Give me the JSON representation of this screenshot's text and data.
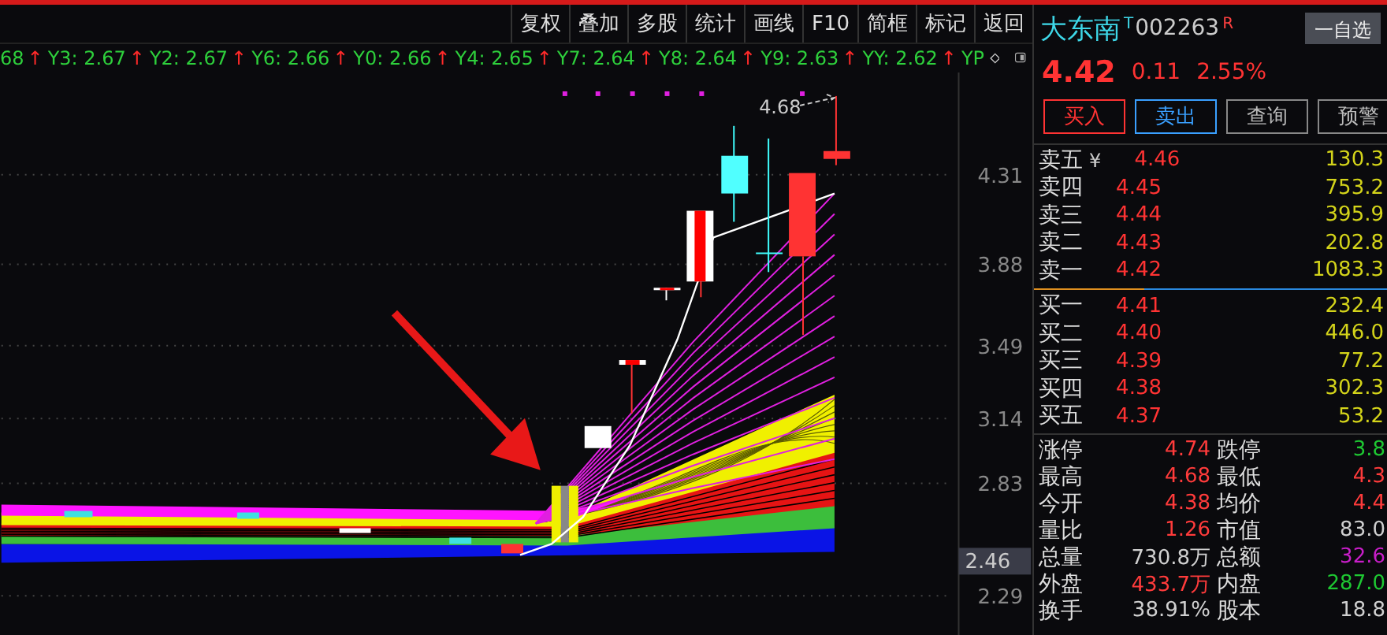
{
  "toolbar": {
    "buttons": [
      "复权",
      "叠加",
      "多股",
      "统计",
      "画线",
      "F10",
      "简框",
      "标记",
      "返回"
    ]
  },
  "indicators": {
    "items": [
      {
        "text": "68",
        "arrow": "↑"
      },
      {
        "text": "Y3: 2.67",
        "arrow": "↑"
      },
      {
        "text": "Y2: 2.67",
        "arrow": "↑"
      },
      {
        "text": "Y6: 2.66",
        "arrow": "↑"
      },
      {
        "text": "Y0: 2.66",
        "arrow": "↑"
      },
      {
        "text": "Y4: 2.65",
        "arrow": "↑"
      },
      {
        "text": "Y7: 2.64",
        "arrow": "↑"
      },
      {
        "text": "Y8: 2.64",
        "arrow": "↑"
      },
      {
        "text": "Y9: 2.63",
        "arrow": "↑"
      },
      {
        "text": "YY: 2.62",
        "arrow": "↑"
      },
      {
        "text": "YP"
      }
    ]
  },
  "chart": {
    "axis_labels": [
      "4.31",
      "3.88",
      "3.49",
      "3.14",
      "2.83",
      "2.29"
    ],
    "current_tag": "2.46",
    "high_label": "4.68"
  },
  "quote": {
    "name": "大东南",
    "name_mark": "T",
    "code": "002263",
    "code_mark": "R",
    "watch_button": "一自选",
    "price": "4.42",
    "change": "0.11",
    "change_pct": "2.55%",
    "actions": [
      {
        "label": "买入",
        "kind": "buy"
      },
      {
        "label": "卖出",
        "kind": "sell"
      },
      {
        "label": "查询",
        "kind": "plain"
      },
      {
        "label": "预警",
        "kind": "plain"
      }
    ]
  },
  "order_book": {
    "asks": [
      {
        "label": "卖五",
        "mark": "¥",
        "price": "4.46",
        "volume": "130.3"
      },
      {
        "label": "卖四",
        "price": "4.45",
        "volume": "753.2"
      },
      {
        "label": "卖三",
        "price": "4.44",
        "volume": "395.9"
      },
      {
        "label": "卖二",
        "price": "4.43",
        "volume": "202.8"
      },
      {
        "label": "卖一",
        "price": "4.42",
        "volume": "1083.3"
      }
    ],
    "bids": [
      {
        "label": "买一",
        "price": "4.41",
        "volume": "232.4"
      },
      {
        "label": "买二",
        "price": "4.40",
        "volume": "446.0"
      },
      {
        "label": "买三",
        "price": "4.39",
        "volume": "77.2"
      },
      {
        "label": "买四",
        "price": "4.38",
        "volume": "302.3"
      },
      {
        "label": "买五",
        "price": "4.37",
        "volume": "53.2"
      }
    ]
  },
  "stats": [
    {
      "label": "涨停",
      "value": "4.74",
      "color": "#ff3b3b"
    },
    {
      "label": "跌停",
      "value": "3.8",
      "color": "#1ec832"
    },
    {
      "label": "最高",
      "value": "4.68",
      "color": "#ff3b3b"
    },
    {
      "label": "最低",
      "value": "4.3",
      "color": "#ff3b3b"
    },
    {
      "label": "今开",
      "value": "4.38",
      "color": "#ff3b3b"
    },
    {
      "label": "均价",
      "value": "4.4",
      "color": "#ff3b3b"
    },
    {
      "label": "量比",
      "value": "1.26",
      "color": "#ff3b3b"
    },
    {
      "label": "市值",
      "value": "83.0",
      "color": "#d0d0d0"
    },
    {
      "label": "总量",
      "value": "730.8万",
      "color": "#d0d0d0"
    },
    {
      "label": "总额",
      "value": "32.6",
      "color": "#c81ec8"
    },
    {
      "label": "外盘",
      "value": "433.7万",
      "color": "#ff3b3b"
    },
    {
      "label": "内盘",
      "value": "287.0",
      "color": "#1ec832"
    },
    {
      "label": "换手",
      "value": "38.91%",
      "color": "#d0d0d0"
    },
    {
      "label": "股本",
      "value": "18.8",
      "color": "#d0d0d0"
    }
  ]
}
